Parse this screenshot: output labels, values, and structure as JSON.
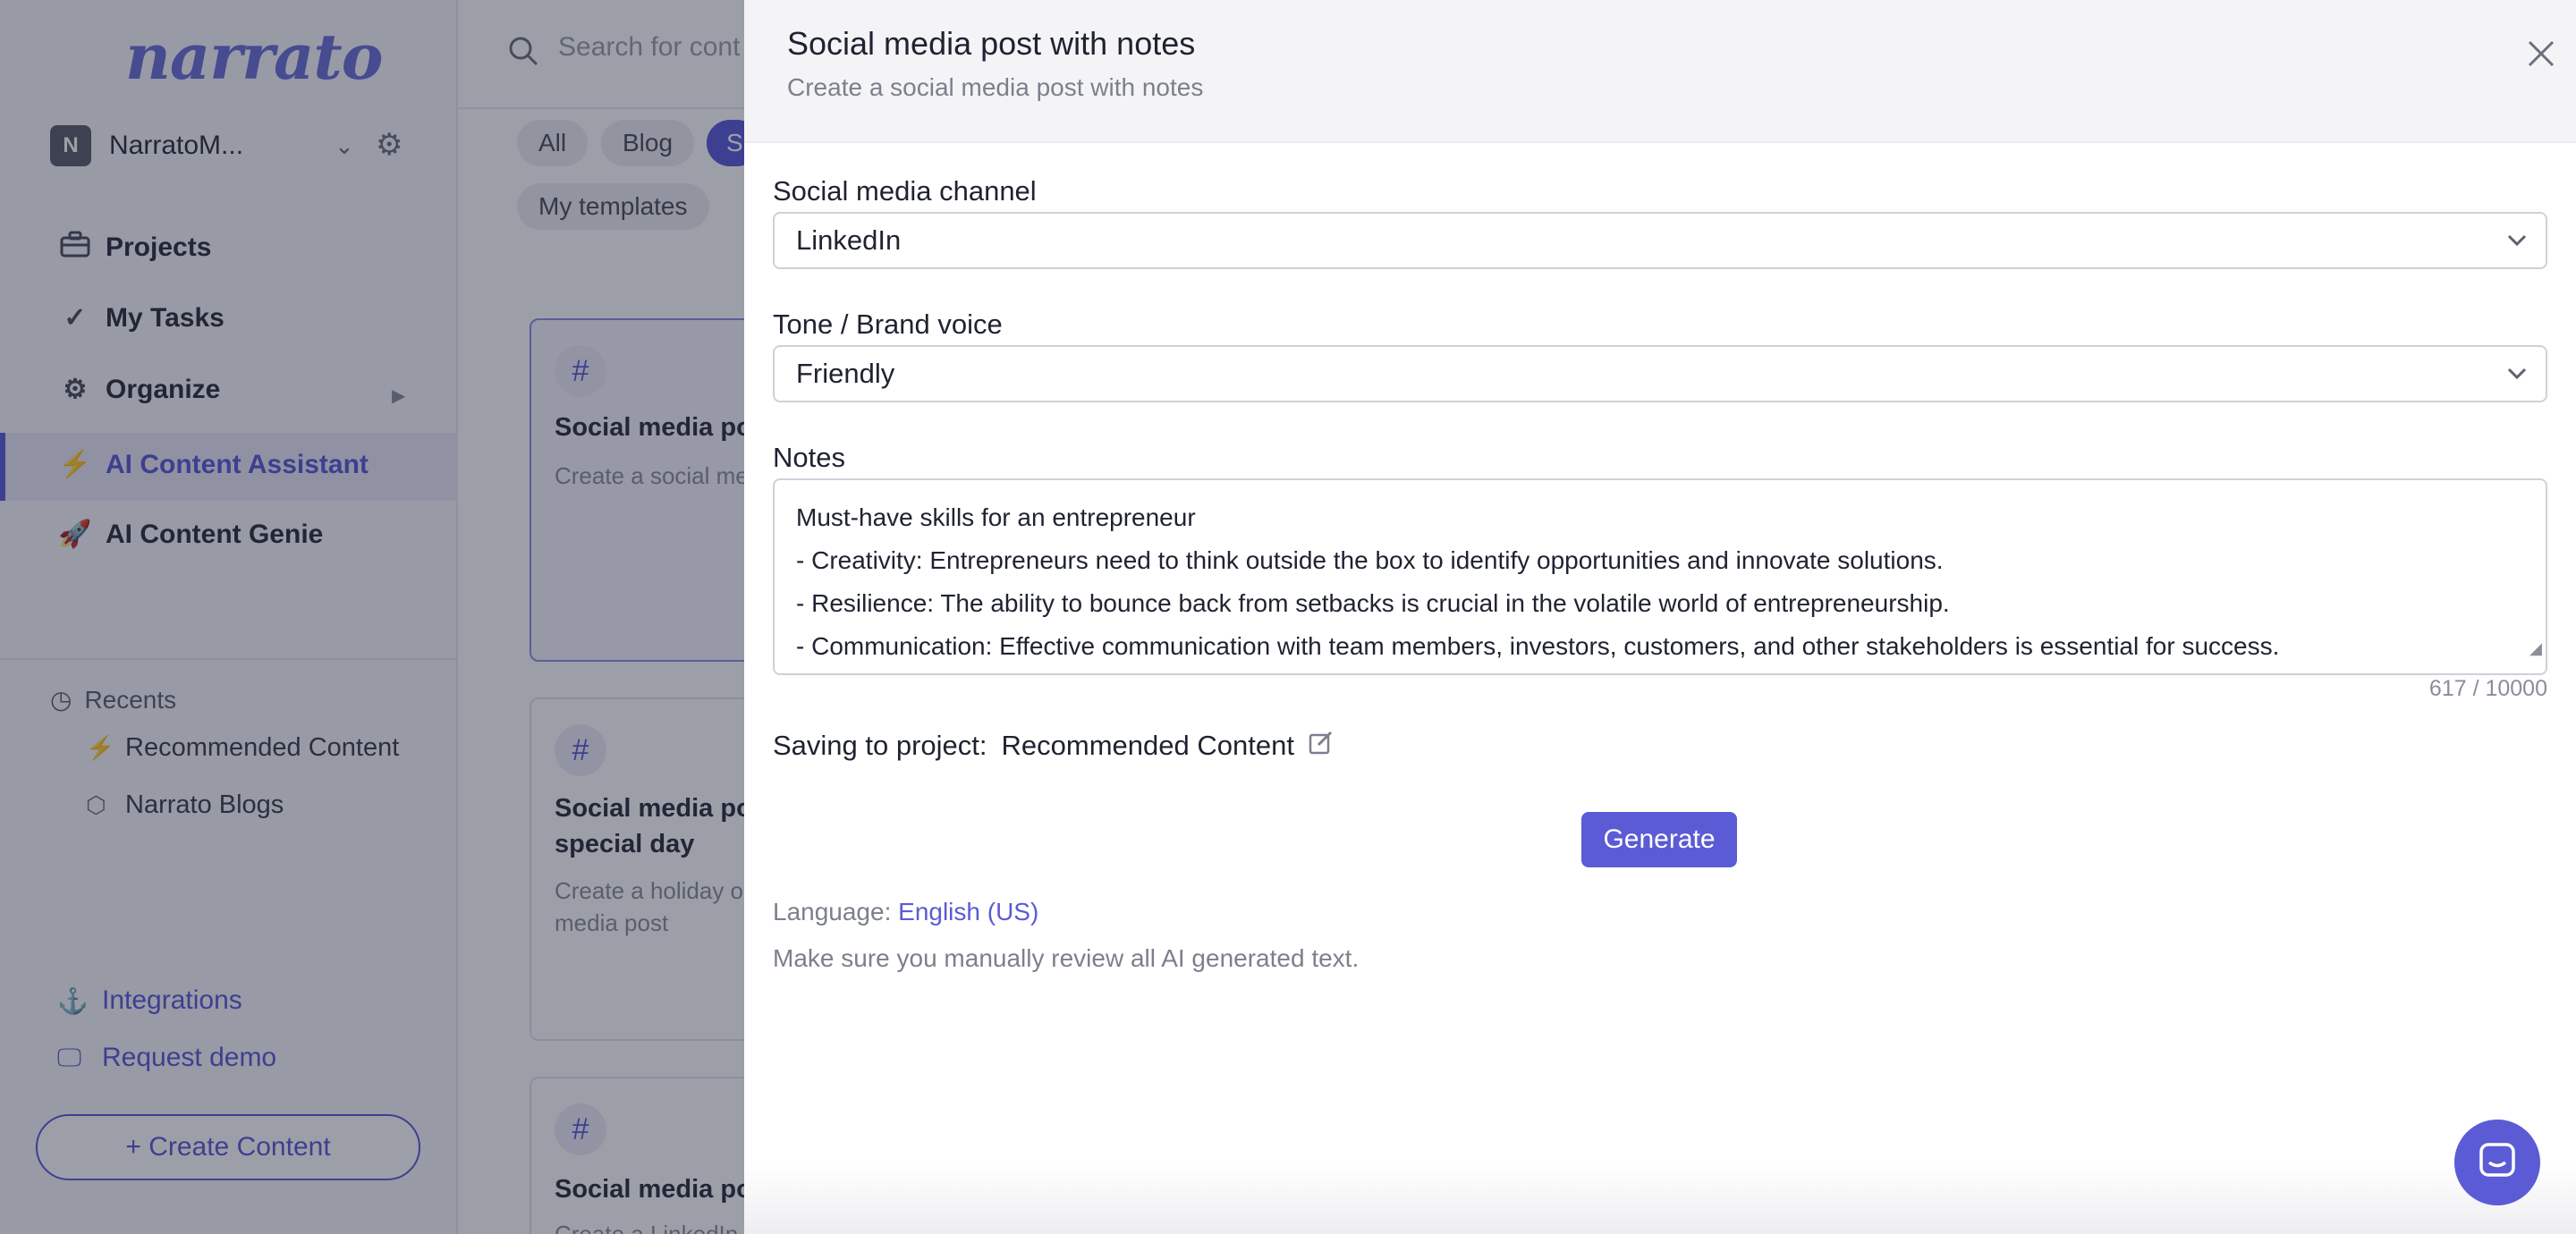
{
  "app": {
    "logo": "narrato",
    "workspace": {
      "initial": "N",
      "name": "NarratoM..."
    },
    "nav": [
      {
        "label": "Projects",
        "icon": "briefcase-icon"
      },
      {
        "label": "My Tasks",
        "icon": "check-icon"
      },
      {
        "label": "Organize",
        "icon": "gears-icon"
      },
      {
        "label": "AI Content Assistant",
        "icon": "lightning-icon",
        "active": true
      },
      {
        "label": "AI Content Genie",
        "icon": "rocket-icon"
      }
    ],
    "recents": {
      "title": "Recents",
      "items": [
        {
          "label": "Recommended Content",
          "icon": "lightning-icon"
        },
        {
          "label": "Narrato Blogs",
          "icon": "cube-icon"
        }
      ]
    },
    "bottom_links": [
      {
        "label": "Integrations",
        "icon": "anchor-icon"
      },
      {
        "label": "Request demo",
        "icon": "monitor-icon"
      }
    ],
    "create_button": "+ Create Content",
    "search_placeholder": "Search for cont",
    "filters": [
      "All",
      "Blog",
      "S"
    ],
    "my_templates": "My templates",
    "cards": [
      {
        "title": "Social media po",
        "desc": "Create a social me"
      },
      {
        "title": "Social media po",
        "title2": "special day",
        "desc": "Create a holiday o",
        "desc2": "media post"
      },
      {
        "title": "Social media po",
        "desc": "Create a LinkedIn"
      }
    ]
  },
  "modal": {
    "title": "Social media post with notes",
    "subtitle": "Create a social media post with notes",
    "channel": {
      "label": "Social media channel",
      "value": "LinkedIn"
    },
    "tone": {
      "label": "Tone / Brand voice",
      "value": "Friendly"
    },
    "notes": {
      "label": "Notes",
      "lines": [
        "Must-have skills for an entrepreneur",
        "- Creativity: Entrepreneurs need to think outside the box to identify opportunities and innovate solutions.",
        "- Resilience: The ability to bounce back from setbacks is crucial in the volatile world of entrepreneurship.",
        "- Communication: Effective communication with team members, investors, customers, and other stakeholders is essential for success."
      ],
      "counter": "617 / 10000"
    },
    "saving": {
      "label": "Saving to project:",
      "project": "Recommended Content"
    },
    "generate_label": "Generate",
    "language": {
      "label": "Language:",
      "value": "English (US)"
    },
    "disclaimer": "Make sure you manually review all AI generated text."
  },
  "colors": {
    "accent": "#5b5bd6",
    "overlay": "rgba(22,26,48,0.42)"
  }
}
